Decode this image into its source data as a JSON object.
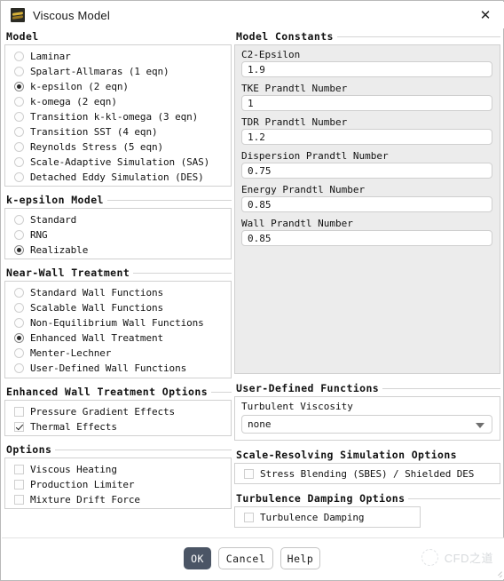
{
  "window": {
    "title": "Viscous Model",
    "close_label": "✕"
  },
  "model": {
    "heading": "Model",
    "options": [
      {
        "label": "Laminar",
        "selected": false
      },
      {
        "label": "Spalart-Allmaras (1 eqn)",
        "selected": false
      },
      {
        "label": "k-epsilon (2 eqn)",
        "selected": true
      },
      {
        "label": "k-omega (2 eqn)",
        "selected": false
      },
      {
        "label": "Transition k-kl-omega (3 eqn)",
        "selected": false
      },
      {
        "label": "Transition SST (4 eqn)",
        "selected": false
      },
      {
        "label": "Reynolds Stress (5 eqn)",
        "selected": false
      },
      {
        "label": "Scale-Adaptive Simulation (SAS)",
        "selected": false
      },
      {
        "label": "Detached Eddy Simulation (DES)",
        "selected": false
      }
    ]
  },
  "k_epsilon_model": {
    "heading": "k-epsilon Model",
    "options": [
      {
        "label": "Standard",
        "selected": false
      },
      {
        "label": "RNG",
        "selected": false
      },
      {
        "label": "Realizable",
        "selected": true
      }
    ]
  },
  "near_wall_treatment": {
    "heading": "Near-Wall Treatment",
    "options": [
      {
        "label": "Standard Wall Functions",
        "selected": false
      },
      {
        "label": "Scalable Wall Functions",
        "selected": false
      },
      {
        "label": "Non-Equilibrium Wall Functions",
        "selected": false
      },
      {
        "label": "Enhanced Wall Treatment",
        "selected": true
      },
      {
        "label": "Menter-Lechner",
        "selected": false
      },
      {
        "label": "User-Defined Wall Functions",
        "selected": false
      }
    ]
  },
  "enhanced_wall_treatment_options": {
    "heading": "Enhanced Wall Treatment Options",
    "options": [
      {
        "label": "Pressure Gradient Effects",
        "checked": false
      },
      {
        "label": "Thermal Effects",
        "checked": true
      }
    ]
  },
  "options": {
    "heading": "Options",
    "items": [
      {
        "label": "Viscous Heating",
        "checked": false
      },
      {
        "label": "Production Limiter",
        "checked": false
      },
      {
        "label": "Mixture Drift Force",
        "checked": false
      }
    ]
  },
  "model_constants": {
    "heading": "Model Constants",
    "fields": [
      {
        "label": "C2-Epsilon",
        "value": "1.9"
      },
      {
        "label": "TKE Prandtl Number",
        "value": "1"
      },
      {
        "label": "TDR Prandtl Number",
        "value": "1.2"
      },
      {
        "label": "Dispersion Prandtl Number",
        "value": "0.75"
      },
      {
        "label": "Energy Prandtl Number",
        "value": "0.85"
      },
      {
        "label": "Wall Prandtl Number",
        "value": "0.85"
      }
    ]
  },
  "user_defined_functions": {
    "heading": "User-Defined Functions",
    "field_label": "Turbulent Viscosity",
    "selected": "none"
  },
  "scale_resolving": {
    "heading": "Scale-Resolving Simulation Options",
    "options": [
      {
        "label": "Stress Blending (SBES) / Shielded DES",
        "checked": false
      }
    ]
  },
  "turbulence_damping": {
    "heading": "Turbulence Damping Options",
    "options": [
      {
        "label": "Turbulence Damping",
        "checked": false
      }
    ]
  },
  "footer": {
    "ok": "OK",
    "cancel": "Cancel",
    "help": "Help",
    "watermark": "CFD之道"
  },
  "colors": {
    "accent": "#4b5565",
    "panel_border": "#d0d0d0",
    "filled_panel": "#ececec"
  }
}
